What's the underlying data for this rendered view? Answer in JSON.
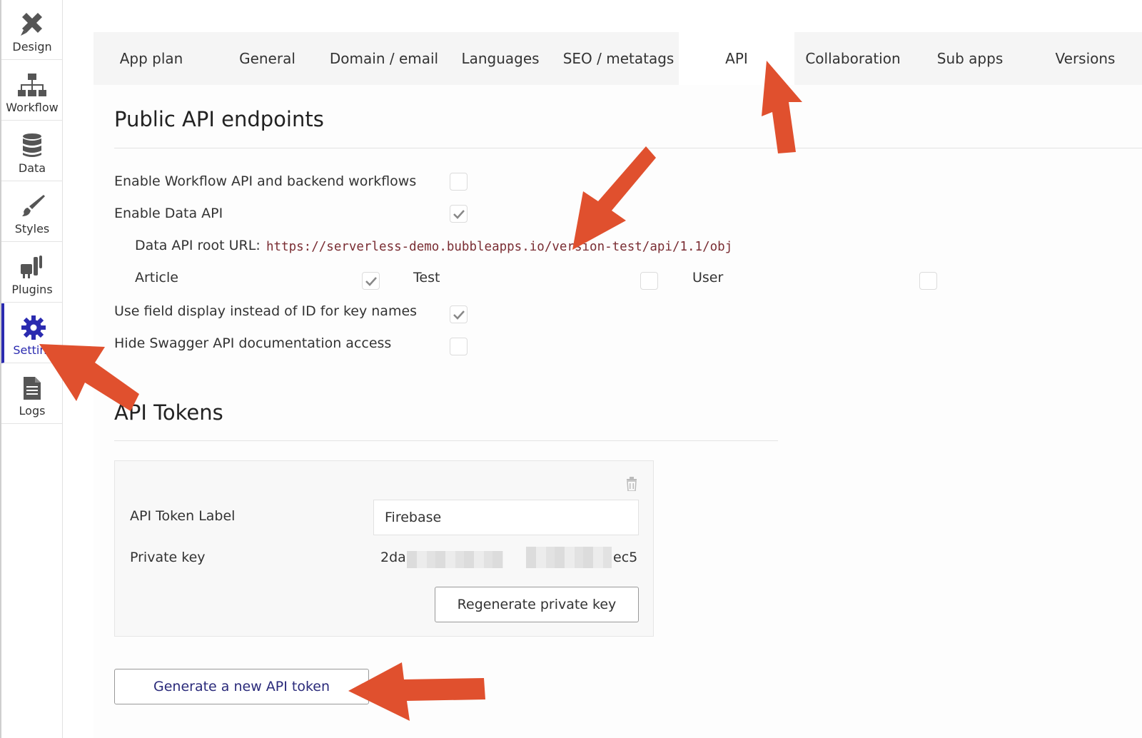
{
  "sidebar": {
    "items": [
      {
        "label": "Design",
        "icon": "design-icon"
      },
      {
        "label": "Workflow",
        "icon": "workflow-icon"
      },
      {
        "label": "Data",
        "icon": "database-icon"
      },
      {
        "label": "Styles",
        "icon": "brush-icon"
      },
      {
        "label": "Plugins",
        "icon": "plug-icon"
      },
      {
        "label": "Setting",
        "icon": "gear-icon",
        "active": true
      },
      {
        "label": "Logs",
        "icon": "document-icon"
      }
    ]
  },
  "tabs": [
    {
      "label": "App plan"
    },
    {
      "label": "General"
    },
    {
      "label": "Domain / email"
    },
    {
      "label": "Languages"
    },
    {
      "label": "SEO / metatags"
    },
    {
      "label": "API",
      "active": true
    },
    {
      "label": "Collaboration"
    },
    {
      "label": "Sub apps"
    },
    {
      "label": "Versions"
    }
  ],
  "public_api": {
    "title": "Public API endpoints",
    "enable_workflow": {
      "label": "Enable Workflow API and backend workflows",
      "checked": false
    },
    "enable_data": {
      "label": "Enable Data API",
      "checked": true
    },
    "root_url_label": "Data API root URL:",
    "root_url": "https://serverless-demo.bubbleapps.io/version-test/api/1.1/obj",
    "types": [
      {
        "label": "Article",
        "checked": true
      },
      {
        "label": "Test",
        "checked": false
      },
      {
        "label": "User",
        "checked": false
      }
    ],
    "field_display": {
      "label": "Use field display instead of ID for key names",
      "checked": true
    },
    "hide_swagger": {
      "label": "Hide Swagger API documentation access",
      "checked": false
    }
  },
  "tokens": {
    "title": "API Tokens",
    "label_field_label": "API Token Label",
    "label_value": "Firebase",
    "private_key_label": "Private key",
    "private_key_start": "2da",
    "private_key_end": "ec5",
    "regenerate_label": "Regenerate private key",
    "generate_label": "Generate a new API token"
  },
  "colors": {
    "accent": "#2b2bb0",
    "arrow": "#e0502e",
    "url": "#7a2d33"
  }
}
